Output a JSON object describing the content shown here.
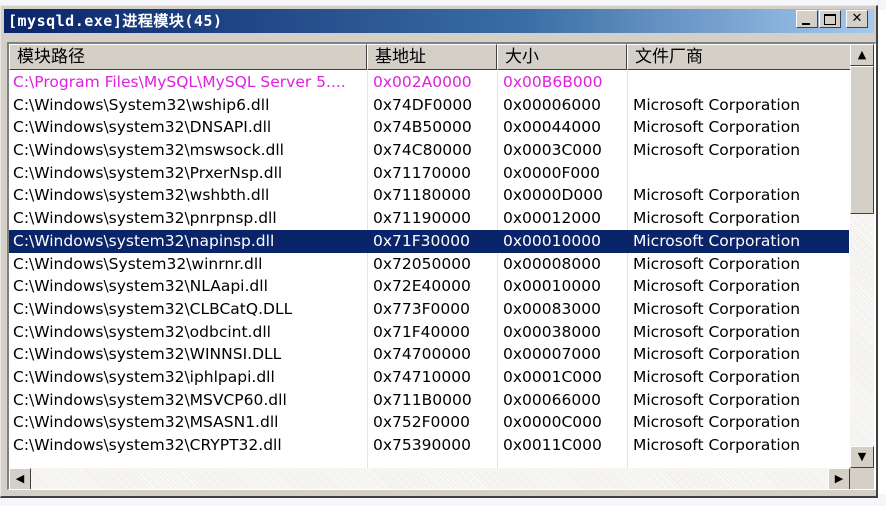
{
  "window": {
    "title": "[mysqld.exe]进程模块(45)",
    "minimize_label": "_",
    "maximize_label": "□",
    "close_label": "✕"
  },
  "columns": [
    "模块路径",
    "基地址",
    "大小",
    "文件厂商"
  ],
  "rows": [
    {
      "path": "C:\\Program Files\\MySQL\\MySQL Server 5....",
      "base": "0x002A0000",
      "size": "0x00B6B000",
      "vendor": ""
    },
    {
      "path": "C:\\Windows\\System32\\wship6.dll",
      "base": "0x74DF0000",
      "size": "0x00006000",
      "vendor": "Microsoft Corporation"
    },
    {
      "path": "C:\\Windows\\system32\\DNSAPI.dll",
      "base": "0x74B50000",
      "size": "0x00044000",
      "vendor": "Microsoft Corporation"
    },
    {
      "path": "C:\\Windows\\system32\\mswsock.dll",
      "base": "0x74C80000",
      "size": "0x0003C000",
      "vendor": "Microsoft Corporation"
    },
    {
      "path": "C:\\Windows\\system32\\PrxerNsp.dll",
      "base": "0x71170000",
      "size": "0x0000F000",
      "vendor": ""
    },
    {
      "path": "C:\\Windows\\system32\\wshbth.dll",
      "base": "0x71180000",
      "size": "0x0000D000",
      "vendor": "Microsoft Corporation"
    },
    {
      "path": "C:\\Windows\\system32\\pnrpnsp.dll",
      "base": "0x71190000",
      "size": "0x00012000",
      "vendor": "Microsoft Corporation"
    },
    {
      "path": "C:\\Windows\\system32\\napinsp.dll",
      "base": "0x71F30000",
      "size": "0x00010000",
      "vendor": "Microsoft Corporation"
    },
    {
      "path": "C:\\Windows\\System32\\winrnr.dll",
      "base": "0x72050000",
      "size": "0x00008000",
      "vendor": "Microsoft Corporation"
    },
    {
      "path": "C:\\Windows\\system32\\NLAapi.dll",
      "base": "0x72E40000",
      "size": "0x00010000",
      "vendor": "Microsoft Corporation"
    },
    {
      "path": "C:\\Windows\\system32\\CLBCatQ.DLL",
      "base": "0x773F0000",
      "size": "0x00083000",
      "vendor": "Microsoft Corporation"
    },
    {
      "path": "C:\\Windows\\system32\\odbcint.dll",
      "base": "0x71F40000",
      "size": "0x00038000",
      "vendor": "Microsoft Corporation"
    },
    {
      "path": "C:\\Windows\\system32\\WINNSI.DLL",
      "base": "0x74700000",
      "size": "0x00007000",
      "vendor": "Microsoft Corporation"
    },
    {
      "path": "C:\\Windows\\system32\\iphlpapi.dll",
      "base": "0x74710000",
      "size": "0x0001C000",
      "vendor": "Microsoft Corporation"
    },
    {
      "path": "C:\\Windows\\system32\\MSVCP60.dll",
      "base": "0x711B0000",
      "size": "0x00066000",
      "vendor": "Microsoft Corporation"
    },
    {
      "path": "C:\\Windows\\system32\\MSASN1.dll",
      "base": "0x752F0000",
      "size": "0x0000C000",
      "vendor": "Microsoft Corporation"
    },
    {
      "path": "C:\\Windows\\system32\\CRYPT32.dll",
      "base": "0x75390000",
      "size": "0x0011C000",
      "vendor": "Microsoft Corporation"
    }
  ],
  "selected_row_index": 7,
  "special_row_index": 0,
  "colors": {
    "title_gradient_start": "#0a246a",
    "selection": "#0a246a",
    "special_row_text": "#e020e0",
    "face": "#d4d0c8"
  },
  "scrollbars": {
    "up_icon": "arrow-up-icon",
    "down_icon": "arrow-down-icon",
    "left_icon": "arrow-left-icon",
    "right_icon": "arrow-right-icon",
    "up_glyph": "▲",
    "down_glyph": "▼",
    "left_glyph": "◀",
    "right_glyph": "▶"
  }
}
